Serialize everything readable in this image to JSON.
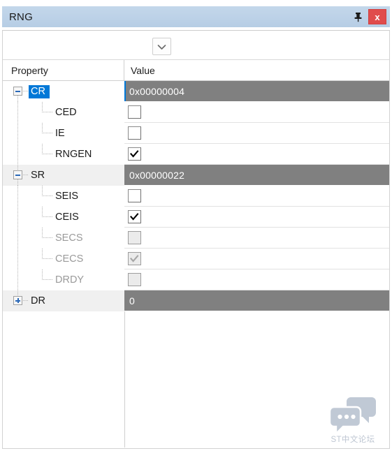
{
  "window": {
    "title": "RNG",
    "pin_icon": "pin-icon",
    "close_label": "x"
  },
  "toolbar": {
    "dropdown_value": "",
    "dropdown_icon": "chevron-down-icon"
  },
  "grid": {
    "columns": [
      "Property",
      "Value"
    ],
    "rows": [
      {
        "label": "CR",
        "level": 0,
        "value": "0x00000004",
        "kind": "register",
        "expander": "minus",
        "selected": true,
        "disabled": false
      },
      {
        "label": "CED",
        "level": 1,
        "value": "",
        "kind": "checkbox",
        "checked": false,
        "selected": false,
        "disabled": false
      },
      {
        "label": "IE",
        "level": 1,
        "value": "",
        "kind": "checkbox",
        "checked": false,
        "selected": false,
        "disabled": false
      },
      {
        "label": "RNGEN",
        "level": 1,
        "value": "",
        "kind": "checkbox",
        "checked": true,
        "selected": false,
        "disabled": false
      },
      {
        "label": "SR",
        "level": 0,
        "value": "0x00000022",
        "kind": "register",
        "expander": "minus",
        "selected": false,
        "disabled": false
      },
      {
        "label": "SEIS",
        "level": 1,
        "value": "",
        "kind": "checkbox",
        "checked": false,
        "selected": false,
        "disabled": false
      },
      {
        "label": "CEIS",
        "level": 1,
        "value": "",
        "kind": "checkbox",
        "checked": true,
        "selected": false,
        "disabled": false
      },
      {
        "label": "SECS",
        "level": 1,
        "value": "",
        "kind": "checkbox",
        "checked": false,
        "selected": false,
        "disabled": true
      },
      {
        "label": "CECS",
        "level": 1,
        "value": "",
        "kind": "checkbox",
        "checked": true,
        "selected": false,
        "disabled": true
      },
      {
        "label": "DRDY",
        "level": 1,
        "value": "",
        "kind": "checkbox",
        "checked": false,
        "selected": false,
        "disabled": true
      },
      {
        "label": "DR",
        "level": 0,
        "value": "0",
        "kind": "register",
        "expander": "plus",
        "selected": false,
        "disabled": false
      }
    ]
  },
  "watermark": {
    "text": "ST中文论坛",
    "icon": "speech-bubbles-icon"
  },
  "colors": {
    "titlebar": "#bdd2e8",
    "selection": "#0078d7",
    "register_row": "#808080",
    "group_row": "#f0f0f0",
    "close_button": "#e04c4c"
  }
}
